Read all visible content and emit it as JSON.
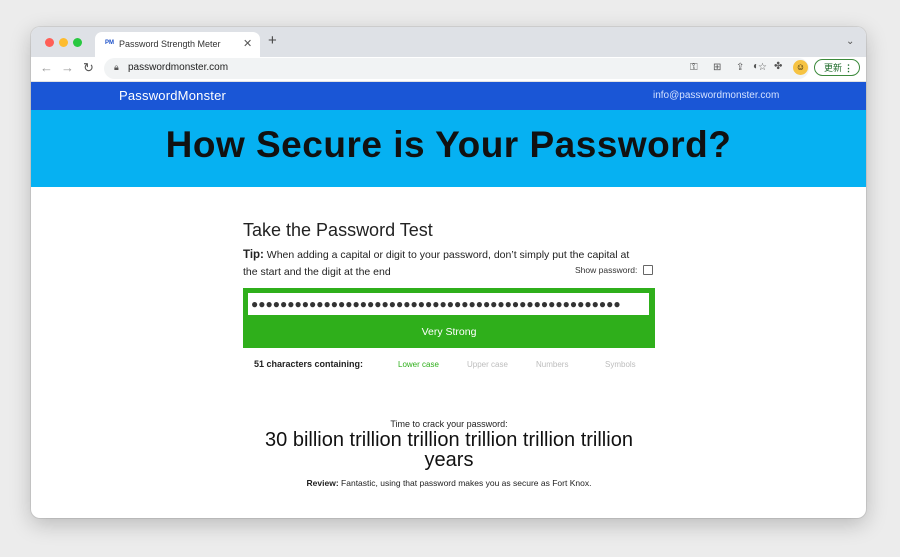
{
  "browser": {
    "tab": {
      "favicon": "PM",
      "title": "Password Strength Meter"
    },
    "new_tab_icon": "+",
    "url": "passwordmonster.com",
    "update_label": "更新"
  },
  "site": {
    "logo": "PasswordMonster",
    "email": "info@passwordmonster.com",
    "hero_title": "How Secure is Your Password?"
  },
  "test": {
    "heading": "Take the Password Test",
    "tip_label": "Tip:",
    "tip_text": "When adding a capital or digit to your password, don’t simply put the capital at the start and the digit at the end",
    "show_password_label": "Show password:",
    "show_password_checked": false,
    "password_masked": "●●●●●●●●●●●●●●●●●●●●●●●●●●●●●●●●●●●●●●●●●●●●●●●●●●●",
    "strength_label": "Very Strong",
    "strength_color": "#2faf1b",
    "characters_summary": "51 characters containing:",
    "categories": [
      {
        "label": "Lower case",
        "active": true
      },
      {
        "label": "Upper case",
        "active": false
      },
      {
        "label": "Numbers",
        "active": false
      },
      {
        "label": "Symbols",
        "active": false
      }
    ],
    "crack_label": "Time to crack your password:",
    "crack_time": "30 billion trillion trillion trillion trillion trillion years",
    "review_label": "Review:",
    "review_text": "Fantastic, using that password makes you as secure as Fort Knox."
  }
}
